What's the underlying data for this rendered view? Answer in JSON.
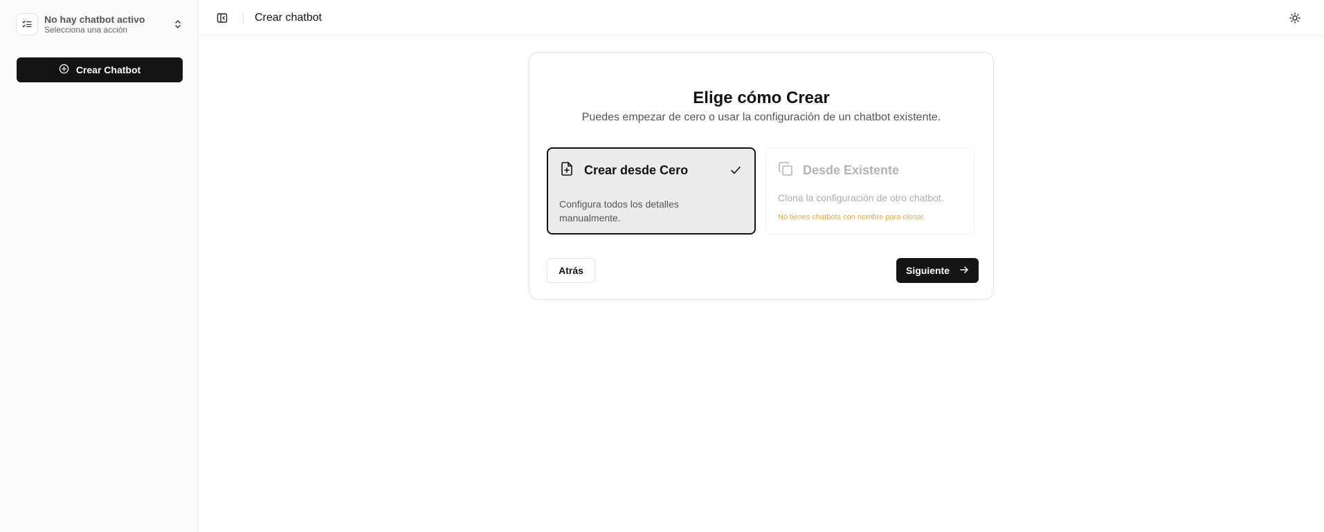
{
  "sidebar": {
    "switcher": {
      "title": "No hay chatbot activo",
      "subtitle": "Selecciona una acción",
      "icon": "list-check-icon",
      "chevron_icon": "chevrons-up-down-icon"
    },
    "create_button": {
      "label": "Crear Chatbot",
      "icon": "plus-circle-icon"
    }
  },
  "topbar": {
    "title": "Crear chatbot",
    "toggle_icon": "sidebar-toggle-icon",
    "theme_icon": "sun-icon"
  },
  "card": {
    "title": "Elige cómo Crear",
    "subtitle": "Puedes empezar de cero o usar la configuración de un chatbot existente.",
    "options": [
      {
        "title": "Crear desde Cero",
        "description": "Configura todos los detalles manualmente.",
        "icon": "file-plus-icon",
        "selected": true
      },
      {
        "title": "Desde Existente",
        "description": "Clona la configuración de otro chatbot.",
        "warning": "No tienes chatbots con nombre para clonar.",
        "icon": "copy-icon",
        "disabled": true
      }
    ],
    "back_label": "Atrás",
    "next_label": "Siguiente"
  },
  "colors": {
    "primary": "#141414",
    "warning": "#f3a63a",
    "selected_bg": "#ebebeb"
  }
}
